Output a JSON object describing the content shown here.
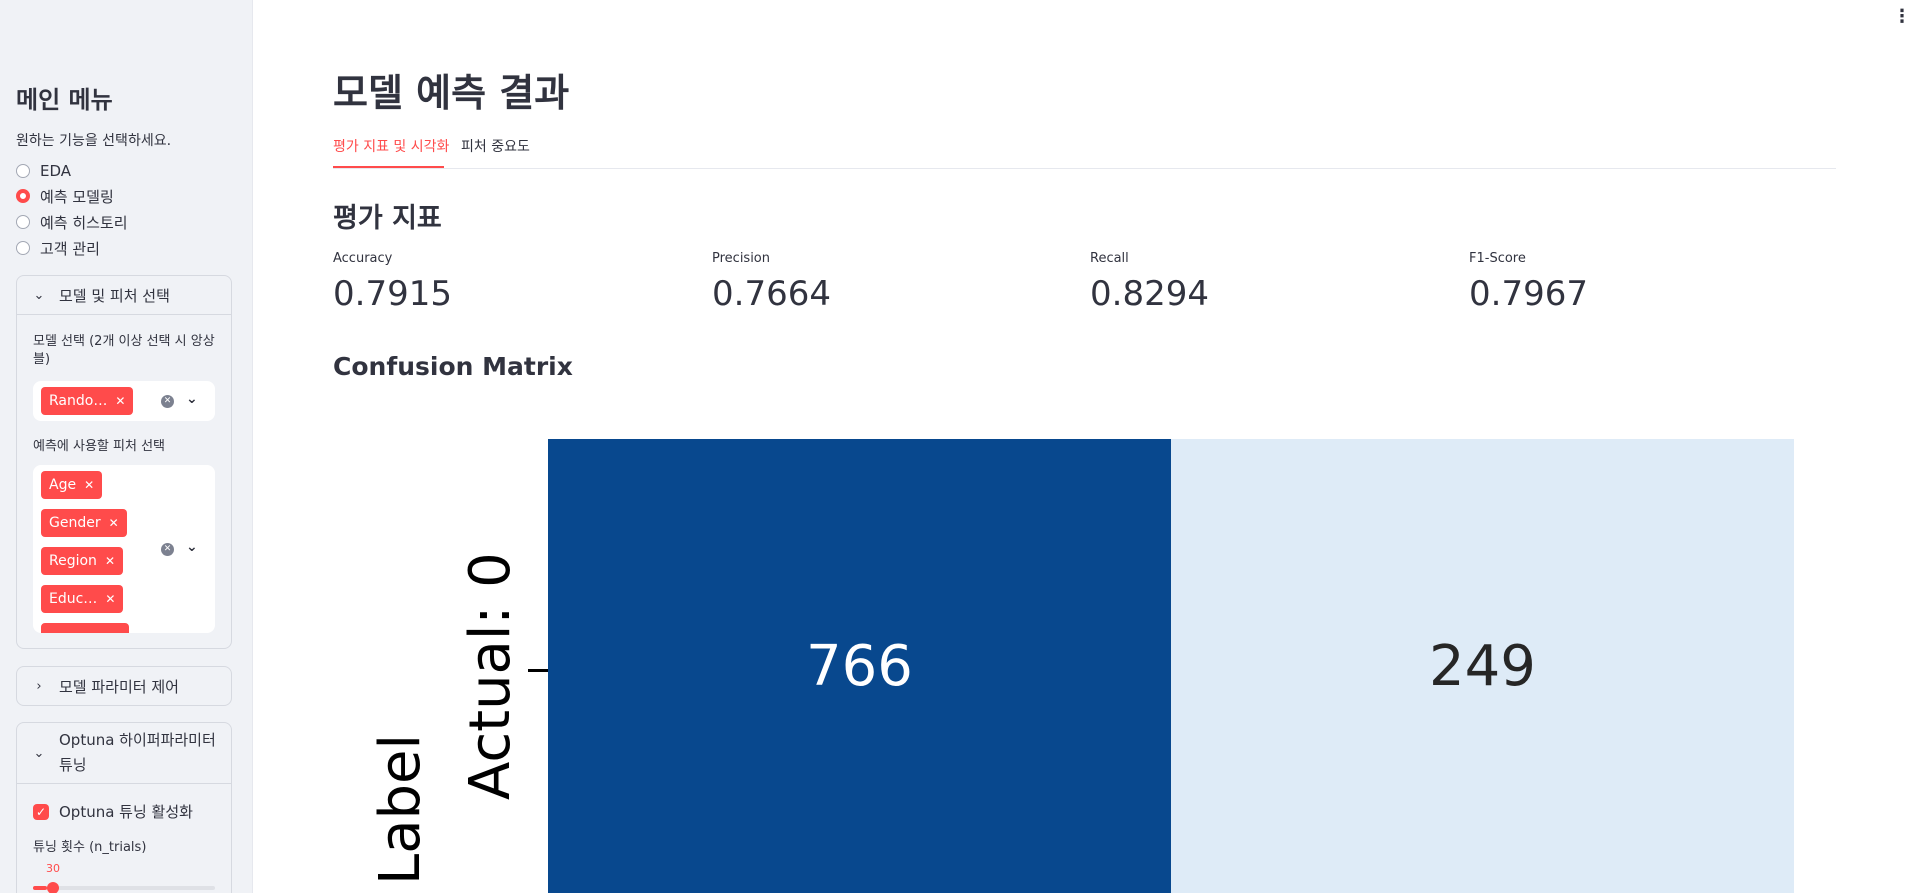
{
  "sidebar": {
    "title": "메인 메뉴",
    "subtitle": "원하는 기능을 선택하세요.",
    "radio_options": [
      {
        "label": "EDA",
        "selected": false
      },
      {
        "label": "예측 모델링",
        "selected": true
      },
      {
        "label": "예측 히스토리",
        "selected": false
      },
      {
        "label": "고객 관리",
        "selected": false
      }
    ],
    "model_expander": {
      "title": "모델 및 피처 선택",
      "expanded": true,
      "model_label": "모델 선택 (2개 이상 선택 시 앙상블)",
      "model_tags": [
        "Rando…"
      ],
      "feature_label": "예측에 사용할 피처 선택",
      "feature_tags": [
        "Age",
        "Gender",
        "Region",
        "Educ…"
      ]
    },
    "param_expander": {
      "title": "모델 파라미터 제어",
      "expanded": false
    },
    "optuna_expander": {
      "title": "Optuna 하이퍼파라미터 튜닝",
      "expanded": true,
      "checkbox_label": "Optuna 튜닝 활성화",
      "checked": true,
      "slider_label": "튜닝 횟수 (n_trials)",
      "slider_value": "30"
    }
  },
  "main": {
    "title": "모델 예측 결과",
    "tabs": [
      {
        "label": "평가 지표 및 시각화",
        "active": true
      },
      {
        "label": "피처 중요도",
        "active": false
      }
    ],
    "metrics_title": "평가 지표",
    "metrics": [
      {
        "label": "Accuracy",
        "value": "0.7915"
      },
      {
        "label": "Precision",
        "value": "0.7664"
      },
      {
        "label": "Recall",
        "value": "0.8294"
      },
      {
        "label": "F1-Score",
        "value": "0.7967"
      }
    ],
    "cm_title": "Confusion Matrix"
  },
  "chart_data": {
    "type": "heatmap",
    "row_labels": [
      "Actual: 0"
    ],
    "y_axis_label": "Label",
    "cells": [
      [
        766,
        249
      ]
    ],
    "colors": {
      "high": "#08488e",
      "low": "#deebf7"
    }
  }
}
